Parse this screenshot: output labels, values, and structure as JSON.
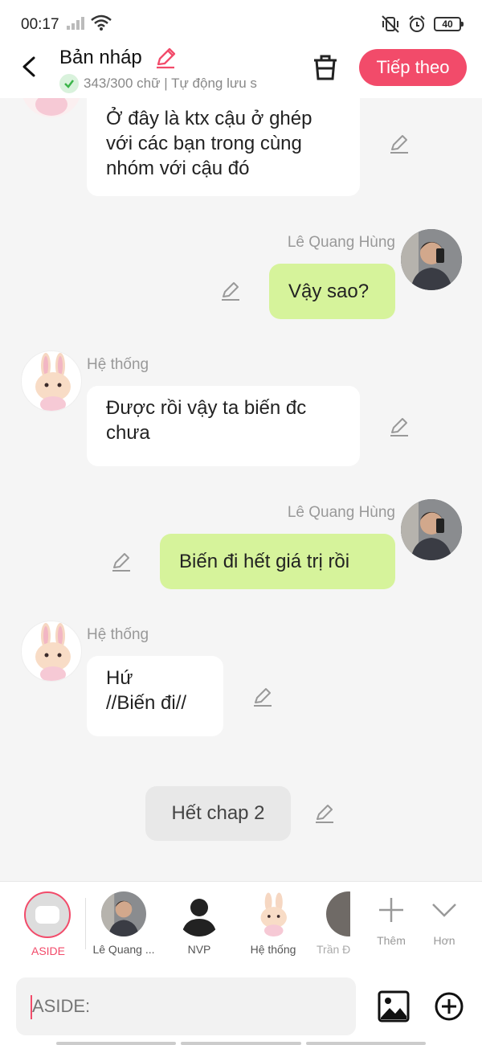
{
  "status_bar": {
    "time": "00:17",
    "battery": "40"
  },
  "header": {
    "title": "Bản nháp",
    "subtitle": "343/300 chữ | Tự động lưu s",
    "next_label": "Tiếp theo"
  },
  "messages": [
    {
      "text": "Ở đây là ktx cậu ở ghép\nvới các bạn trong cùng\nnhóm với cậu đó"
    },
    {
      "name": "Lê Quang Hùng",
      "text": "Vậy sao?"
    },
    {
      "name": "Hệ thống",
      "text": "Được rồi vậy ta biến đc\nchưa"
    },
    {
      "name": "Lê Quang Hùng",
      "text": "Biến đi hết giá trị rồi"
    },
    {
      "name": "Hệ thống",
      "text": "Hứ\n//Biến đi//"
    },
    {
      "text": "Hết chap 2"
    }
  ],
  "characters": [
    {
      "label": "ASIDE",
      "color": "#f24b6a"
    },
    {
      "label": "Lê Quang ..."
    },
    {
      "label": "NVP"
    },
    {
      "label": "Hệ thống"
    },
    {
      "label": "Trần Đ"
    },
    {
      "label": "Thêm"
    },
    {
      "label": "Hơn"
    }
  ],
  "input": {
    "placeholder": "ASIDE:"
  },
  "colors": {
    "accent": "#f24b6a",
    "green_bubble": "#d6f39b",
    "background": "#f5f5f5"
  }
}
